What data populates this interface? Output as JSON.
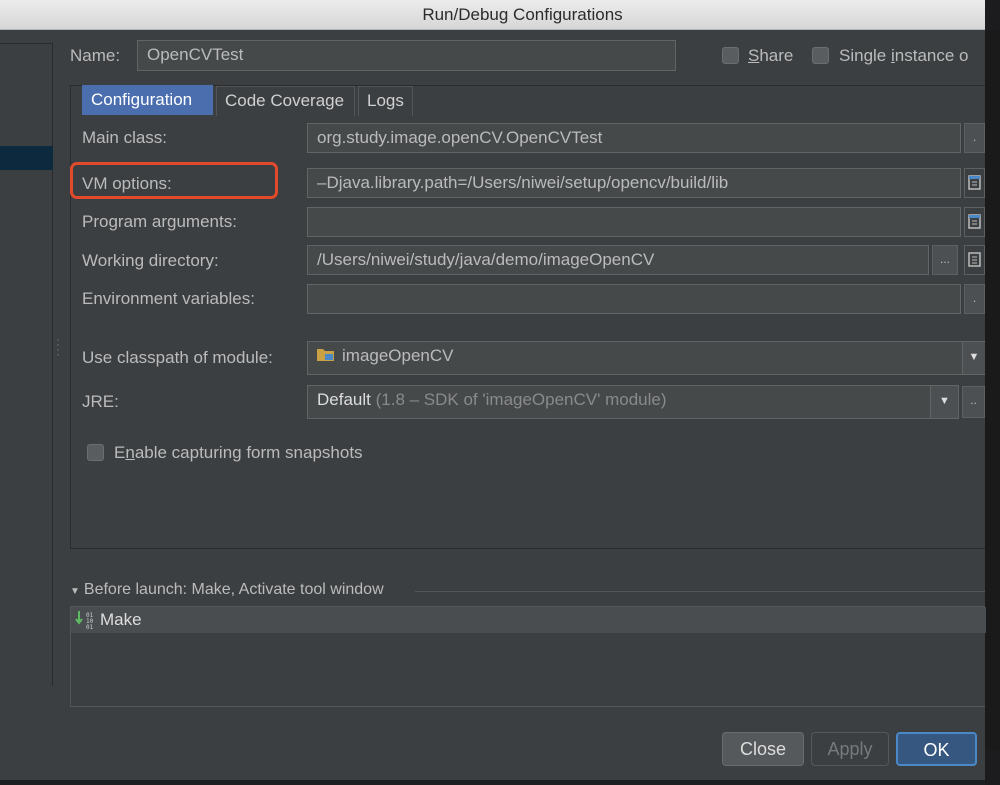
{
  "window": {
    "title": "Run/Debug Configurations"
  },
  "header": {
    "name_label": "Name:",
    "name_value": "OpenCVTest",
    "share_label": "Share",
    "single_instance_label": "Single instance o"
  },
  "tabs": [
    {
      "label": "Configuration"
    },
    {
      "label": "Code Coverage"
    },
    {
      "label": "Logs"
    }
  ],
  "form": {
    "main_class_label": "Main class:",
    "main_class_value": "org.study.image.openCV.OpenCVTest",
    "vm_options_label": "VM options:",
    "vm_options_value": "–Djava.library.path=/Users/niwei/setup/opencv/build/lib",
    "program_args_label": "Program arguments:",
    "program_args_value": "",
    "working_dir_label": "Working directory:",
    "working_dir_value": "/Users/niwei/study/java/demo/imageOpenCV",
    "env_vars_label": "Environment variables:",
    "env_vars_value": "",
    "classpath_label": "Use classpath of module:",
    "classpath_value": "imageOpenCV",
    "jre_label": "JRE:",
    "jre_value": "Default",
    "jre_detail": "(1.8 – SDK of 'imageOpenCV' module)",
    "snapshots_label": "Enable capturing form snapshots",
    "browse_ellipsis": "..."
  },
  "before_launch": {
    "header": "Before launch: Make, Activate tool window",
    "items": [
      {
        "label": "Make"
      }
    ]
  },
  "buttons": {
    "close": "Close",
    "apply": "Apply",
    "ok": "OK"
  },
  "colors": {
    "background": "#3c3f41",
    "accent": "#4b6eaf",
    "highlight_border": "#e24a2c",
    "ok_button": "#365880"
  }
}
